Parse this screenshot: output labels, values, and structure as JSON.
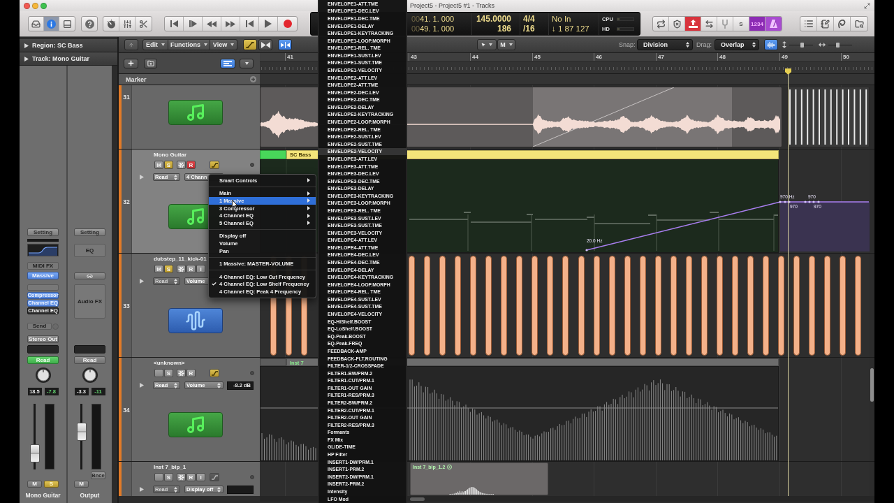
{
  "window": {
    "title": "Project5 - Project5 #1 - Tracks"
  },
  "toolbar": {
    "view_buttons": [
      {
        "kind": "library",
        "selected": false
      },
      {
        "kind": "inspector",
        "selected": true
      },
      {
        "kind": "editors",
        "selected": false
      }
    ],
    "lcd": {
      "position_prefix": "00",
      "position": "41. 1. 000",
      "end_prefix": "00",
      "end": "49. 1. 000",
      "tempo": "145.0000",
      "tempo_sub": "186",
      "signature": "4/4",
      "division": "/16",
      "input": "No In",
      "output": "↓ 1 87 127",
      "cpu_label": "CPU",
      "hd_label": "HD"
    },
    "mode_buttons": [
      {
        "kind": "cycle",
        "on": false
      },
      {
        "kind": "replace",
        "on": false
      },
      {
        "kind": "autopunch",
        "on": true
      },
      {
        "kind": "align",
        "on": false
      },
      {
        "kind": "tuner",
        "on": false
      },
      {
        "kind": "solo",
        "label": "S",
        "on": false
      },
      {
        "kind": "count-in",
        "label": "1234",
        "on": true
      },
      {
        "kind": "metronome",
        "on": true
      }
    ]
  },
  "inspector": {
    "sections": [
      {
        "label": "Region: SC Bass",
        "expanded": false
      },
      {
        "label": "Track: Mono Guitar",
        "expanded": false
      }
    ],
    "strips": [
      {
        "kind": "instrument",
        "setting": "Setting",
        "midi_fx": "MIDI FX",
        "instrument": {
          "label": "Massive",
          "on": true
        },
        "audio_fx": [
          {
            "label": "Compressor",
            "on": true
          },
          {
            "label": "Channel EQ",
            "on": true
          },
          {
            "label": "Channel EQ",
            "on": false
          }
        ],
        "send": "Send",
        "output": "Stereo Out",
        "automation": {
          "label": "Read",
          "on": true
        },
        "readouts": [
          "18.5",
          "-7.8"
        ],
        "fader": {
          "level": 0.15
        },
        "mute": {
          "label": "M",
          "on": false
        },
        "solo": {
          "label": "S",
          "on": true
        },
        "name": "Mono Guitar"
      },
      {
        "kind": "output",
        "setting": "Setting",
        "eq": "EQ",
        "audio_fx_slot": "Audio FX",
        "automation": {
          "label": "Read",
          "on": false
        },
        "readouts": [
          "-3.3",
          "-11"
        ],
        "fader": {
          "level": 0.6
        },
        "bounce": "Bnce",
        "mute": {
          "label": "M",
          "on": false
        },
        "name": "Output"
      }
    ]
  },
  "tracks_toolbar": {
    "menus": [
      "Edit",
      "Functions",
      "View"
    ],
    "modes": [
      {
        "kind": "automation",
        "on": true
      },
      {
        "kind": "catch",
        "on": false
      },
      {
        "kind": "flex",
        "on": true
      }
    ],
    "tools": [
      {
        "kind": "pointer"
      },
      {
        "kind": "text",
        "label": "M"
      }
    ],
    "snap": {
      "label": "Snap:",
      "value": "Division"
    },
    "drag": {
      "label": "Drag:",
      "value": "Overlap"
    },
    "waveform_zoom_on": true,
    "zoom_sliders": [
      {
        "kind": "vertical",
        "level": 0.56
      },
      {
        "kind": "horizontal",
        "level": 0.38
      }
    ]
  },
  "track_list_header": {
    "global_tracks_on": true,
    "marker_label": "Marker"
  },
  "ruler": {
    "bars": [
      "41",
      "43",
      "44",
      "45",
      "46",
      "47",
      "48",
      "49",
      "50"
    ]
  },
  "tracks": [
    {
      "number": "31",
      "kind": "instrument",
      "selected": false,
      "lane": {
        "kind": "audio"
      }
    },
    {
      "number": "32",
      "kind": "instrument",
      "selected": true,
      "name": "Mono Guitar",
      "buttons": [
        {
          "kind": "mute",
          "label": "M",
          "on": false
        },
        {
          "kind": "solo",
          "label": "S",
          "on": true
        },
        {
          "kind": "freeze",
          "on": false
        },
        {
          "kind": "record",
          "label": "R",
          "on": true
        }
      ],
      "automation_button": {
        "on": true
      },
      "automation_expanded": false,
      "mode": {
        "label": "Read",
        "disabled": false
      },
      "parameter": "4 Chann",
      "lane": {
        "kind": "automation",
        "region": "SC Bass",
        "labels": [
          "20.0 Hz",
          "970 Hz",
          "970",
          "970",
          "970"
        ]
      }
    },
    {
      "number": "33",
      "kind": "audio",
      "selected": false,
      "name": "dubstep_11_kick-01",
      "buttons": [
        {
          "kind": "mute",
          "label": "M",
          "on": false
        },
        {
          "kind": "solo",
          "label": "S",
          "on": true
        },
        {
          "kind": "freeze",
          "on": false
        },
        {
          "kind": "record",
          "label": "R",
          "on": false
        },
        {
          "kind": "input",
          "label": "I",
          "on": false
        }
      ],
      "automation_expanded": false,
      "mode": {
        "label": "Read",
        "disabled": true
      },
      "parameter": "Volume",
      "lane": {
        "kind": "drums"
      }
    },
    {
      "number": "34",
      "kind": "instrument",
      "selected": false,
      "name": "<unknown>",
      "buttons": [
        {
          "kind": "blank"
        },
        {
          "kind": "solo",
          "label": "S",
          "on": false
        },
        {
          "kind": "freeze",
          "on": false
        },
        {
          "kind": "record",
          "label": "R",
          "on": false
        }
      ],
      "automation_button": {
        "on": true
      },
      "automation_expanded": false,
      "mode": {
        "label": "Read",
        "disabled": false
      },
      "parameter": "Volume",
      "value": "-8.2 dB",
      "lane": {
        "kind": "midi",
        "region": "Inst 7"
      }
    },
    {
      "selected": false,
      "name": "Inst 7_bip_1",
      "buttons": [
        {
          "kind": "blank"
        },
        {
          "kind": "solo",
          "label": "S",
          "on": false
        },
        {
          "kind": "freeze",
          "on": false
        },
        {
          "kind": "record",
          "label": "R",
          "on": false
        },
        {
          "kind": "input",
          "label": "I",
          "on": false
        }
      ],
      "automation_button": {
        "on": false
      },
      "automation_expanded": false,
      "mode": {
        "label": "Read",
        "disabled": true
      },
      "parameter": "Display off",
      "value_field": true,
      "lane": {
        "kind": "loop",
        "region": "Inst 7_bip_1.2"
      }
    }
  ],
  "context_menu": {
    "items": [
      {
        "kind": "submenu",
        "label": "Smart Controls",
        "selected": false,
        "checked": false
      },
      {
        "kind": "separator"
      },
      {
        "kind": "submenu",
        "label": "Main",
        "selected": false,
        "checked": false
      },
      {
        "kind": "submenu",
        "label": "1 Massive",
        "selected": true,
        "checked": false
      },
      {
        "kind": "submenu",
        "label": "3 Compressor",
        "selected": false,
        "checked": false
      },
      {
        "kind": "submenu",
        "label": "4 Channel EQ",
        "selected": false,
        "checked": false
      },
      {
        "kind": "submenu",
        "label": "5 Channel EQ",
        "selected": false,
        "checked": false
      },
      {
        "kind": "separator"
      },
      {
        "kind": "item",
        "label": "Display off",
        "selected": false,
        "checked": false
      },
      {
        "kind": "item",
        "label": "Volume",
        "selected": false,
        "checked": false
      },
      {
        "kind": "item",
        "label": "Pan",
        "selected": false,
        "checked": false
      },
      {
        "kind": "separator"
      },
      {
        "kind": "item",
        "label": "1 Massive: MASTER-VOLUME",
        "selected": false,
        "checked": false
      },
      {
        "kind": "separator"
      },
      {
        "kind": "item",
        "label": "4 Channel EQ: Low Cut Frequency",
        "selected": false,
        "checked": false
      },
      {
        "kind": "item",
        "label": "4 Channel EQ: Low Shelf Frequency",
        "selected": false,
        "checked": true
      },
      {
        "kind": "item",
        "label": "4 Channel EQ: Peak 4 Frequency",
        "selected": false,
        "checked": false
      }
    ]
  },
  "submenu": {
    "items": [
      {
        "label": "ENVELOPE1-ATT.TME",
        "selected": false
      },
      {
        "label": "ENVELOPE1-DEC.LEV",
        "selected": false
      },
      {
        "label": "ENVELOPE1-DEC.TME",
        "selected": false
      },
      {
        "label": "ENVELOPE1-DELAY",
        "selected": false
      },
      {
        "label": "ENVELOPE1-KEYTRACKING",
        "selected": false
      },
      {
        "label": "ENVELOPE1-LOOP.MORPH",
        "selected": false
      },
      {
        "label": "ENVELOPE1-REL. TME",
        "selected": false
      },
      {
        "label": "ENVELOPE1-SUST.LEV",
        "selected": false
      },
      {
        "label": "ENVELOPE1-SUST.TME",
        "selected": false
      },
      {
        "label": "ENVELOPE1-VELOCITY",
        "selected": false
      },
      {
        "label": "ENVELOPE2-ATT.LEV",
        "selected": false
      },
      {
        "label": "ENVELOPE2-ATT.TME",
        "selected": false
      },
      {
        "label": "ENVELOPE2-DEC.LEV",
        "selected": false
      },
      {
        "label": "ENVELOPE2-DEC.TME",
        "selected": false
      },
      {
        "label": "ENVELOPE2-DELAY",
        "selected": false
      },
      {
        "label": "ENVELOPE2-KEYTRACKING",
        "selected": false
      },
      {
        "label": "ENVELOPE2-LOOP.MORPH",
        "selected": false
      },
      {
        "label": "ENVELOPE2-REL. TME",
        "selected": false
      },
      {
        "label": "ENVELOPE2-SUST.LEV",
        "selected": false
      },
      {
        "label": "ENVELOPE2-SUST.TME",
        "selected": false
      },
      {
        "label": "ENVELOPE2-VELOCITY",
        "selected": true
      },
      {
        "label": "ENVELOPE3-ATT.LEV",
        "selected": false
      },
      {
        "label": "ENVELOPE3-ATT.TME",
        "selected": false
      },
      {
        "label": "ENVELOPE3-DEC.LEV",
        "selected": false
      },
      {
        "label": "ENVELOPE3-DEC.TME",
        "selected": false
      },
      {
        "label": "ENVELOPE3-DELAY",
        "selected": false
      },
      {
        "label": "ENVELOPE3-KEYTRACKING",
        "selected": false
      },
      {
        "label": "ENVELOPE3-LOOP.MORPH",
        "selected": false
      },
      {
        "label": "ENVELOPE3-REL. TME",
        "selected": false
      },
      {
        "label": "ENVELOPE3-SUST.LEV",
        "selected": false
      },
      {
        "label": "ENVELOPE3-SUST.TME",
        "selected": false
      },
      {
        "label": "ENVELOPE3-VELOCITY",
        "selected": false
      },
      {
        "label": "ENVELOPE4-ATT.LEV",
        "selected": false
      },
      {
        "label": "ENVELOPE4-ATT.TME",
        "selected": false
      },
      {
        "label": "ENVELOPE4-DEC.LEV",
        "selected": false
      },
      {
        "label": "ENVELOPE4-DEC.TME",
        "selected": false
      },
      {
        "label": "ENVELOPE4-DELAY",
        "selected": false
      },
      {
        "label": "ENVELOPE4-KEYTRACKING",
        "selected": false
      },
      {
        "label": "ENVELOPE4-LOOP.MORPH",
        "selected": false
      },
      {
        "label": "ENVELOPE4-REL. TME",
        "selected": false
      },
      {
        "label": "ENVELOPE4-SUST.LEV",
        "selected": false
      },
      {
        "label": "ENVELOPE4-SUST.TME",
        "selected": false
      },
      {
        "label": "ENVELOPE4-VELOCITY",
        "selected": false
      },
      {
        "label": "EQ-HiShelf.BOOST",
        "selected": false
      },
      {
        "label": "EQ-LoShelf.BOOST",
        "selected": false
      },
      {
        "label": "EQ-Peak.BOOST",
        "selected": false
      },
      {
        "label": "EQ-Peak.FREQ",
        "selected": false
      },
      {
        "label": "FEEDBACK-AMP",
        "selected": false
      },
      {
        "label": "FEEDBACK-FLT.ROUTING",
        "selected": false
      },
      {
        "label": "FILTER-1/2-CROSSFADE",
        "selected": false
      },
      {
        "label": "FILTER1-BW/PRM.2",
        "selected": false
      },
      {
        "label": "FILTER1-CUT/PRM.1",
        "selected": false
      },
      {
        "label": "FILTER1-OUT GAIN",
        "selected": false
      },
      {
        "label": "FILTER1-RES/PRM.3",
        "selected": false
      },
      {
        "label": "FILTER2-BW/PRM.2",
        "selected": false
      },
      {
        "label": "FILTER2-CUT/PRM.1",
        "selected": false
      },
      {
        "label": "FILTER2-OUT GAIN",
        "selected": false
      },
      {
        "label": "FILTER2-RES/PRM.3",
        "selected": false
      },
      {
        "label": "Formants",
        "selected": false
      },
      {
        "label": "FX Mix",
        "selected": false
      },
      {
        "label": "GLIDE-TIME",
        "selected": false
      },
      {
        "label": "HP Filter",
        "selected": false
      },
      {
        "label": "INSERT1-DW/PRM.1",
        "selected": false
      },
      {
        "label": "INSERT1-PRM.2",
        "selected": false
      },
      {
        "label": "INSERT2-DW/PRM.1",
        "selected": false
      },
      {
        "label": "INSERT2-PRM.2",
        "selected": false
      },
      {
        "label": "Intensity",
        "selected": false
      },
      {
        "label": "LFO Mod",
        "selected": false
      }
    ]
  }
}
